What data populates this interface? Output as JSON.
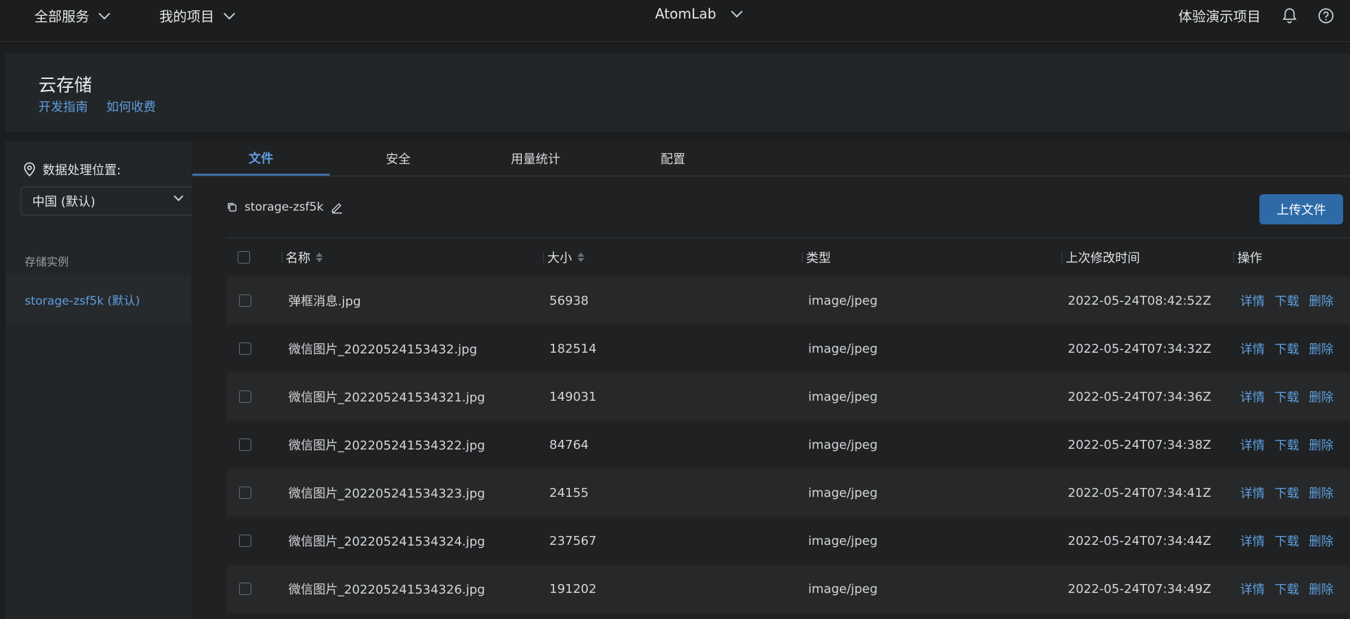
{
  "topbar": {
    "all_services": "全部服务",
    "my_projects": "我的项目",
    "app_name": "AtomLab",
    "demo_project": "体验演示项目"
  },
  "header": {
    "title": "云存储",
    "links": [
      "开发指南",
      "如何收费"
    ]
  },
  "sidebar": {
    "location_label": "数据处理位置:",
    "location_value": "中国 (默认)",
    "section_label": "存储实例",
    "instance": "storage-zsf5k (默认)"
  },
  "tabs": [
    "文件",
    "安全",
    "用量统计",
    "配置"
  ],
  "active_tab": "文件",
  "bucket": {
    "name": "storage-zsf5k"
  },
  "upload_label": "上传文件",
  "table": {
    "headers": [
      "名称",
      "大小",
      "类型",
      "上次修改时间",
      "操作"
    ],
    "actions": [
      "详情",
      "下载",
      "删除"
    ],
    "rows": [
      [
        "弹框消息.jpg",
        "56938",
        "image/jpeg",
        "2022-05-24T08:42:52Z"
      ],
      [
        "微信图片_20220524153432.jpg",
        "182514",
        "image/jpeg",
        "2022-05-24T07:34:32Z"
      ],
      [
        "微信图片_202205241534321.jpg",
        "149031",
        "image/jpeg",
        "2022-05-24T07:34:36Z"
      ],
      [
        "微信图片_202205241534322.jpg",
        "84764",
        "image/jpeg",
        "2022-05-24T07:34:38Z"
      ],
      [
        "微信图片_202205241534323.jpg",
        "24155",
        "image/jpeg",
        "2022-05-24T07:34:41Z"
      ],
      [
        "微信图片_202205241534324.jpg",
        "237567",
        "image/jpeg",
        "2022-05-24T07:34:44Z"
      ],
      [
        "微信图片_202205241534326.jpg",
        "191202",
        "image/jpeg",
        "2022-05-24T07:34:49Z"
      ]
    ]
  },
  "colors": {
    "accent": "#5f9ee0",
    "primary_button": "#2e6aa8",
    "background": "#1b1d1e"
  }
}
